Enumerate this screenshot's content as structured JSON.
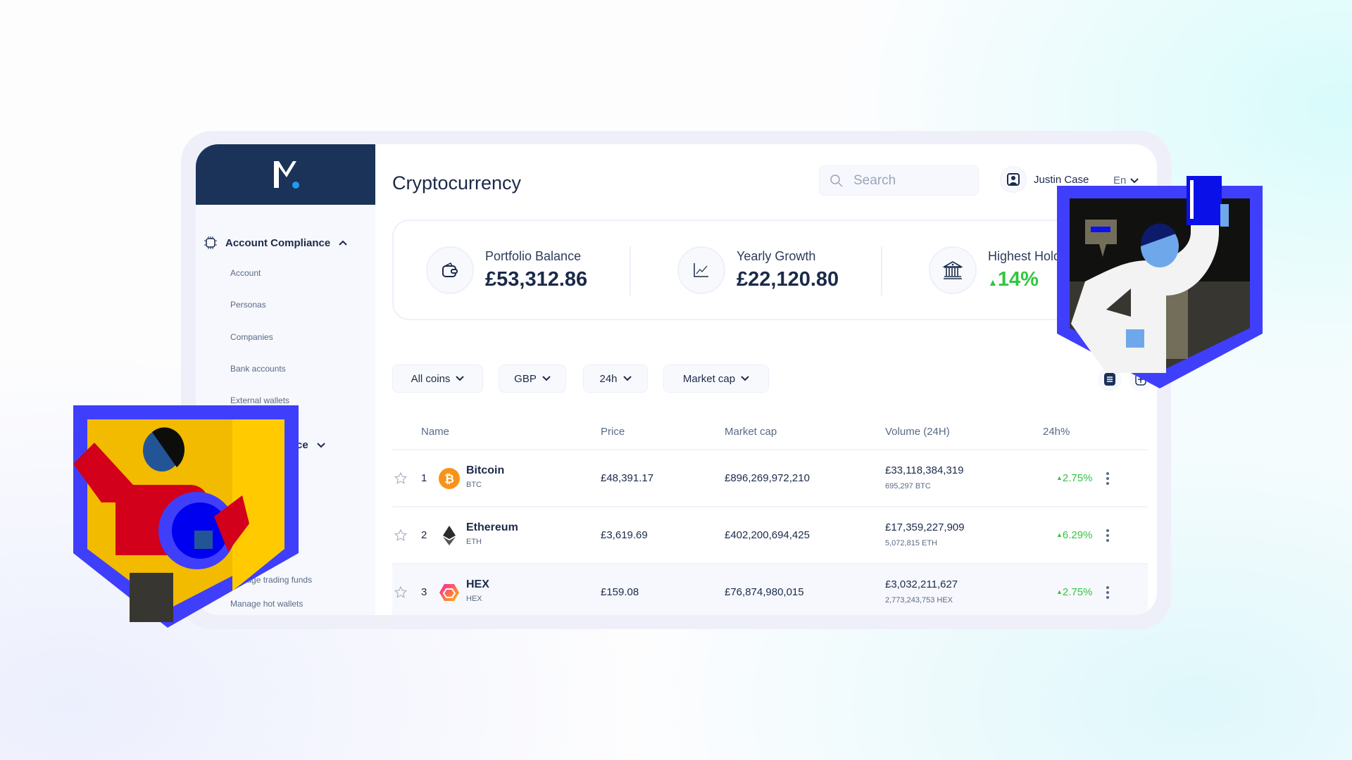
{
  "brand": {
    "logo_text": "M."
  },
  "sidebar": {
    "section1": "Account Compliance",
    "items": [
      "Account",
      "Personas",
      "Companies",
      "Bank accounts",
      "External wallets"
    ],
    "section2_partial": "pliance",
    "items2": [
      "Manage trading funds",
      "Manage hot wallets"
    ]
  },
  "header": {
    "title": "Cryptocurrency",
    "search_placeholder": "Search",
    "user_name": "Justin Case",
    "language": "En"
  },
  "stats": [
    {
      "label": "Portfolio Balance",
      "value": "£53,312.86",
      "icon": "wallet-icon"
    },
    {
      "label": "Yearly Growth",
      "value": "£22,120.80",
      "icon": "chart-line-icon"
    },
    {
      "label": "Highest Holding",
      "value": "14%",
      "icon": "bank-icon"
    }
  ],
  "filters": [
    "All coins",
    "GBP",
    "24h",
    "Market cap"
  ],
  "table": {
    "headers": [
      "Name",
      "Price",
      "Market cap",
      "Volume (24H)",
      "24h%"
    ],
    "rows": [
      {
        "rank": "1",
        "name": "Bitcoin",
        "symbol": "BTC",
        "price": "£48,391.17",
        "market_cap": "£896,269,972,210",
        "volume": "£33,118,384,319",
        "volume_coin": "695,297 BTC",
        "change": "2.75%"
      },
      {
        "rank": "2",
        "name": "Ethereum",
        "symbol": "ETH",
        "price": "£3,619.69",
        "market_cap": "£402,200,694,425",
        "volume": "£17,359,227,909",
        "volume_coin": "5,072,815 ETH",
        "change": "6.29%"
      },
      {
        "rank": "3",
        "name": "HEX",
        "symbol": "HEX",
        "price": "£159.08",
        "market_cap": "£76,874,980,015",
        "volume": "£3,032,211,627",
        "volume_coin": "2,773,243,753 HEX",
        "change": "2.75%"
      }
    ]
  },
  "colors": {
    "navy": "#1b3358",
    "green": "#32c640",
    "accent": "#1e9bf0"
  }
}
